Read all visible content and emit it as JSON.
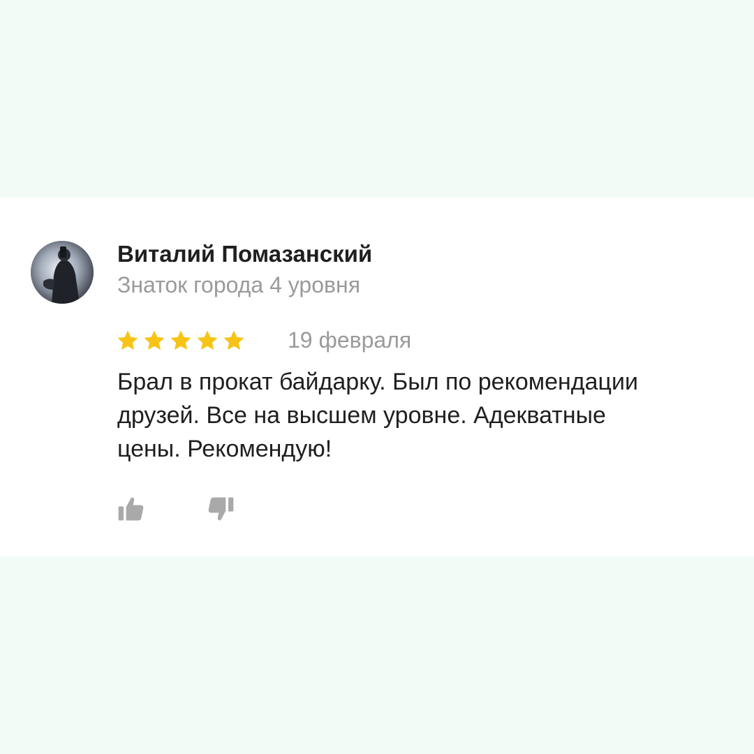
{
  "review": {
    "author": {
      "name": "Виталий Помазанский",
      "level": "Знаток города 4 уровня",
      "avatar_icon": "user-photo-avatar"
    },
    "rating": {
      "value": 5,
      "max": 5,
      "star_color": "#f6c416"
    },
    "date": "19 февраля",
    "text": "Брал в прокат байдарку. Был по рекомендации друзей. Все на высшем уровне. Адекватные цены. Рекомендую!",
    "actions": {
      "like_icon": "thumbs-up-icon",
      "dislike_icon": "thumbs-down-icon",
      "icon_color": "#a9a9a9"
    }
  },
  "colors": {
    "background": "#f3fbf7",
    "card": "#ffffff",
    "primary_text": "#1f1f1f",
    "secondary_text": "#9a9a9a"
  }
}
